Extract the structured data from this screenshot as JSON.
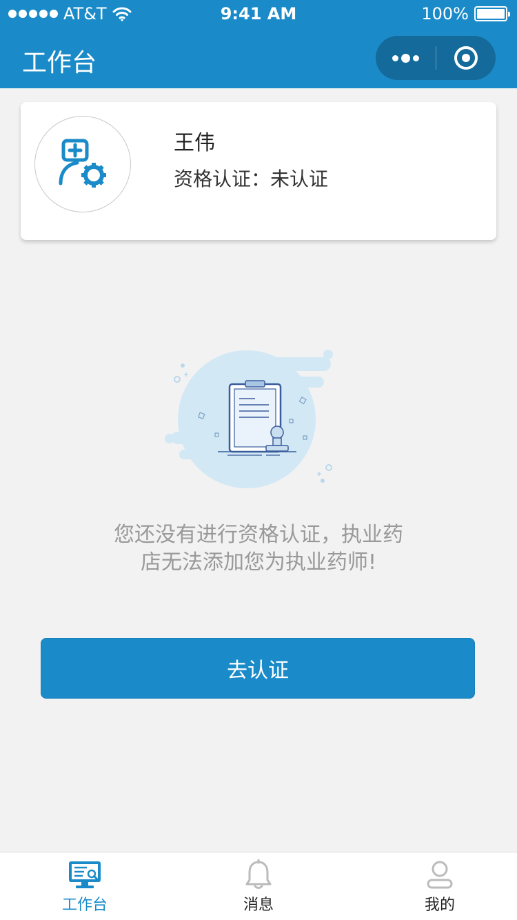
{
  "status_bar": {
    "carrier": "AT&T",
    "time": "9:41 AM",
    "battery": "100%"
  },
  "nav": {
    "title": "工作台"
  },
  "profile": {
    "name": "王伟",
    "certification": "资格认证：未认证"
  },
  "empty_state": {
    "line1": "您还没有进行资格认证，执业药",
    "line2": "店无法添加您为执业药师!"
  },
  "cta": {
    "label": "去认证"
  },
  "tabbar": {
    "items": [
      {
        "label": "工作台",
        "icon": "workbench-icon",
        "active": true
      },
      {
        "label": "消息",
        "icon": "bell-icon",
        "active": false
      },
      {
        "label": "我的",
        "icon": "user-icon",
        "active": false
      }
    ]
  },
  "colors": {
    "primary": "#1a8bc8",
    "capsule": "#136a9b",
    "background": "#f2f2f2",
    "muted_text": "#999999"
  }
}
